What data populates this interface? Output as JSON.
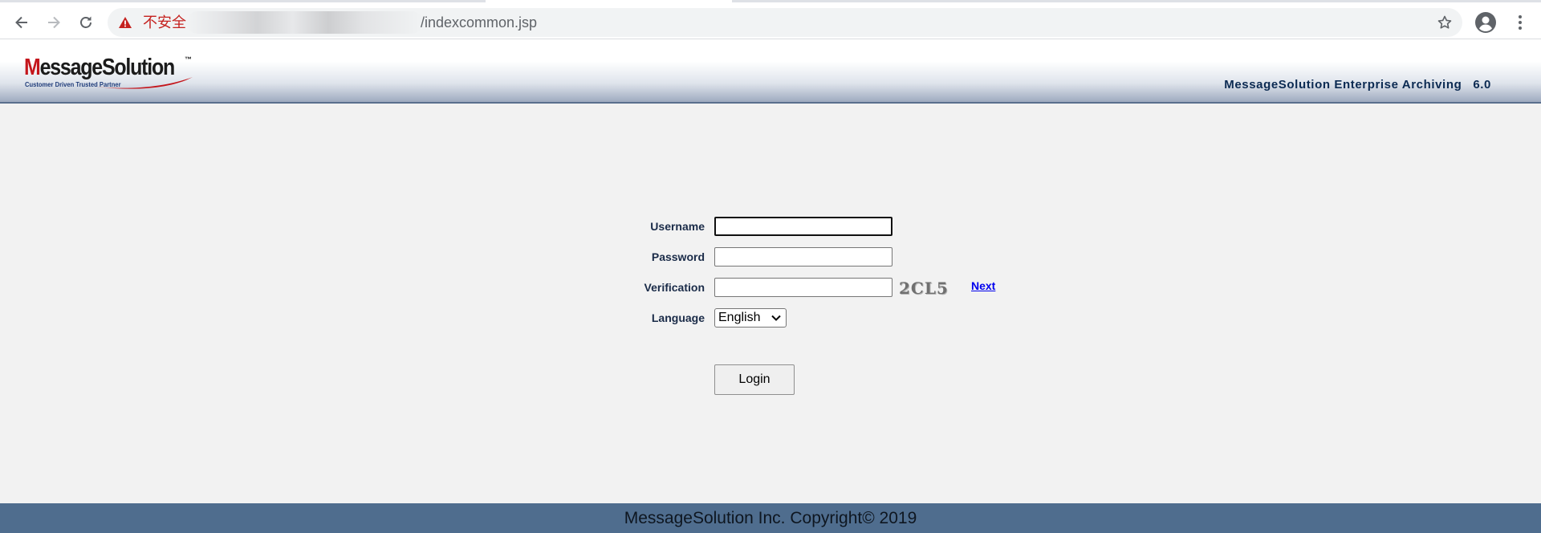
{
  "browser": {
    "security_label": "不安全",
    "url_path": "/indexcommon.jsp",
    "icons": [
      "back-icon",
      "forward-icon",
      "reload-icon",
      "warning-icon",
      "star-icon",
      "profile-icon",
      "menu-icon"
    ]
  },
  "header": {
    "logo": {
      "wordmark_first": "M",
      "wordmark_rest": "essageSolution",
      "trademark": "™",
      "tagline": "Customer Driven Trusted Partner"
    },
    "product_name": "MessageSolution Enterprise Archiving",
    "version": "6.0"
  },
  "login_form": {
    "username_label": "Username",
    "username_value": "",
    "password_label": "Password",
    "password_value": "",
    "verification_label": "Verification",
    "verification_value": "",
    "captcha_text": "2CL5",
    "next_link": "Next",
    "language_label": "Language",
    "language_selected": "English",
    "login_button": "Login"
  },
  "footer": {
    "copyright": "MessageSolution Inc. Copyright© 2019"
  },
  "colors": {
    "security_warning": "#c5221f",
    "header_border": "#5a6f8d",
    "page_background": "#f2f2f2",
    "footer_background": "#4f6d8e",
    "label_text": "#1a2b48",
    "link": "#0000ee"
  }
}
